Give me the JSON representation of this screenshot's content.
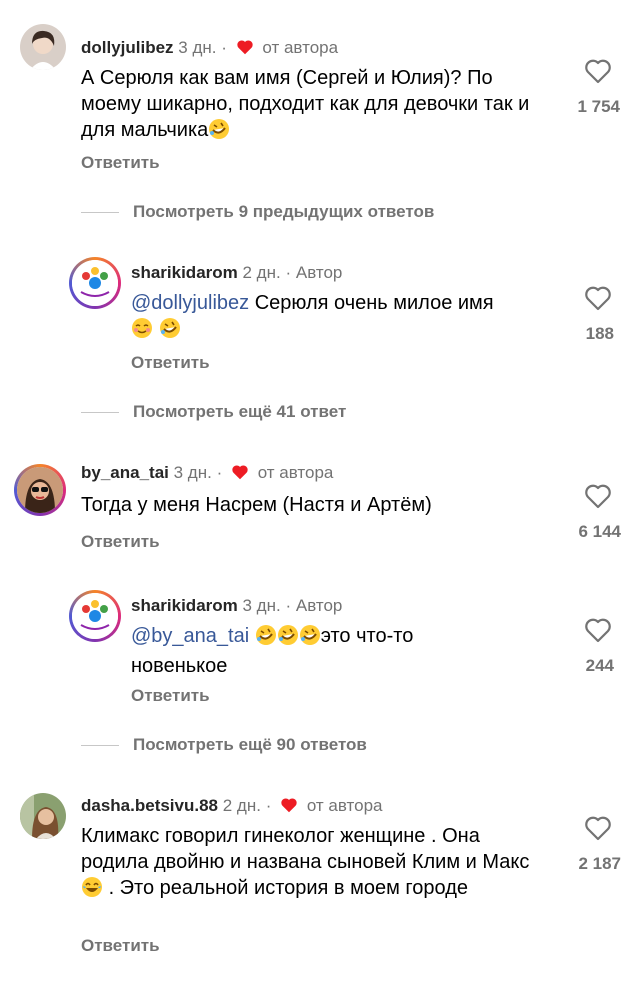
{
  "comments": [
    {
      "user": "dollyjulibez",
      "time": "3 дн.",
      "tag": "от автора",
      "text": "А Серюля как вам имя (Сергей и Юлия)? По моему шикарно, подходит как для девочки так и для мальчика",
      "likes": "1 754",
      "reply": "Ответить"
    },
    {
      "user": "sharikidarom",
      "time": "2 дн.",
      "tag": "Автор",
      "mention": "@dollyjulibez",
      "text": "Серюля очень милое имя",
      "likes": "188",
      "reply": "Ответить"
    },
    {
      "user": "by_ana_tai",
      "time": "3 дн.",
      "tag": "от автора",
      "text": "Тогда у меня Насрем (Настя и Артём)",
      "likes": "6 144",
      "reply": "Ответить"
    },
    {
      "user": "sharikidarom",
      "time": "3 дн.",
      "tag": "Автор",
      "mention": "@by_ana_tai",
      "text": "это что-то новенькое",
      "likes": "244",
      "reply": "Ответить"
    },
    {
      "user": "dasha.betsivu.88",
      "time": "2 дн.",
      "tag": "от автора",
      "text_before": "Климакс говорил гинеколог женщине . Она родила двойню и названа сыновей Клим и Макс",
      "text_after": ". Это реальной история в моем городе",
      "likes": "2 187",
      "reply": "Ответить"
    }
  ],
  "view_more": [
    "Посмотреть 9 предыдущих ответов",
    "Посмотреть ещё 41 ответ",
    "Посмотреть ещё 90 ответов"
  ],
  "separator": "·",
  "colors": {
    "heart": "#ed1c24",
    "mention": "#385898",
    "meta": "#737373"
  },
  "icons": {
    "like": "heart-outline-icon",
    "author_like": "heart-filled-icon"
  }
}
